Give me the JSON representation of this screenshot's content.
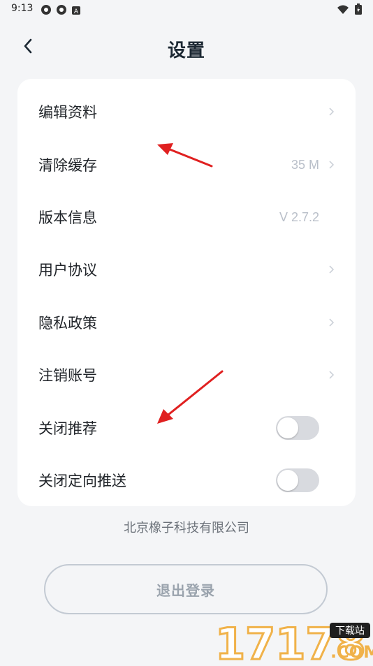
{
  "status_bar": {
    "time": "9:13",
    "icons": [
      "settings-gear-icon",
      "settings-gear-icon",
      "a-badge-icon",
      "wifi-icon",
      "battery-icon"
    ]
  },
  "header": {
    "title": "设置",
    "back_icon": "chevron-left-icon"
  },
  "settings": [
    {
      "label": "编辑资料",
      "value": "",
      "chevron": true
    },
    {
      "label": "清除缓存",
      "value": "35 M",
      "chevron": true
    },
    {
      "label": "版本信息",
      "value": "V 2.7.2",
      "chevron": false
    },
    {
      "label": "用户协议",
      "value": "",
      "chevron": true
    },
    {
      "label": "隐私政策",
      "value": "",
      "chevron": true
    },
    {
      "label": "注销账号",
      "value": "",
      "chevron": true
    }
  ],
  "toggles": [
    {
      "label": "关闭推荐",
      "on": false
    },
    {
      "label": "关闭定向推送",
      "on": false
    }
  ],
  "company": "北京橡子科技有限公司",
  "logout_label": "退出登录",
  "watermark": {
    "number": "17178",
    "badge": "下载站",
    "domain": ".COM"
  },
  "colors": {
    "background": "#f4f5f7",
    "card": "#ffffff",
    "annotation_arrow": "#e02020",
    "muted_text": "#b9bfc9"
  }
}
